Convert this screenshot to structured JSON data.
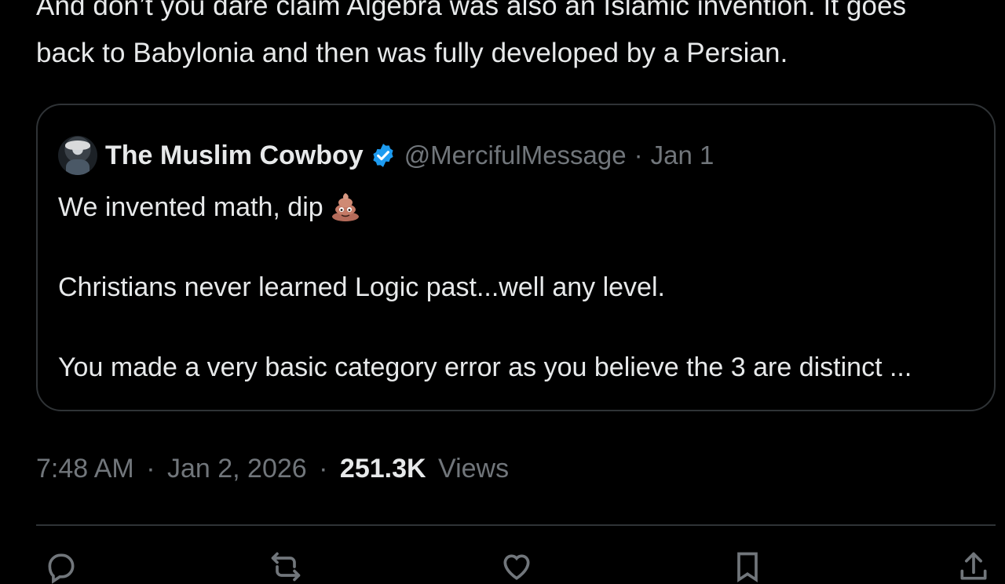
{
  "post": {
    "text_line_1": "And don’t you dare claim Algebra was also an Islamic invention. It goes",
    "text_line_2": "back to Babylonia and then was fully developed by a Persian."
  },
  "quoted_post": {
    "display_name": "The Muslim Cowboy",
    "handle": "@MercifulMessage",
    "separator": "·",
    "date": "Jan 1",
    "line_1": "We invented math, dip",
    "line_1_emoji": "pile-of-poo-emoji",
    "line_2": "Christians never learned Logic past...well any level.",
    "line_3": "You made a very basic category error as you believe the 3 are distinct ..."
  },
  "post_meta": {
    "time": "7:48 AM",
    "separator": "·",
    "date": "Jan 2, 2026",
    "views_count": "251.3K",
    "views_label": "Views"
  },
  "actions": {
    "items": [
      {
        "icon": "reply-icon",
        "count": ""
      },
      {
        "icon": "repost-icon",
        "count": ""
      },
      {
        "icon": "like-icon",
        "count": ""
      },
      {
        "icon": "bookmark-icon",
        "count": ""
      },
      {
        "icon": "share-icon",
        "count": ""
      }
    ]
  },
  "colors": {
    "background": "#000000",
    "text": "#e7e9ea",
    "muted": "#71767b",
    "border": "#2f3336",
    "verified": "#1d9bf0"
  }
}
